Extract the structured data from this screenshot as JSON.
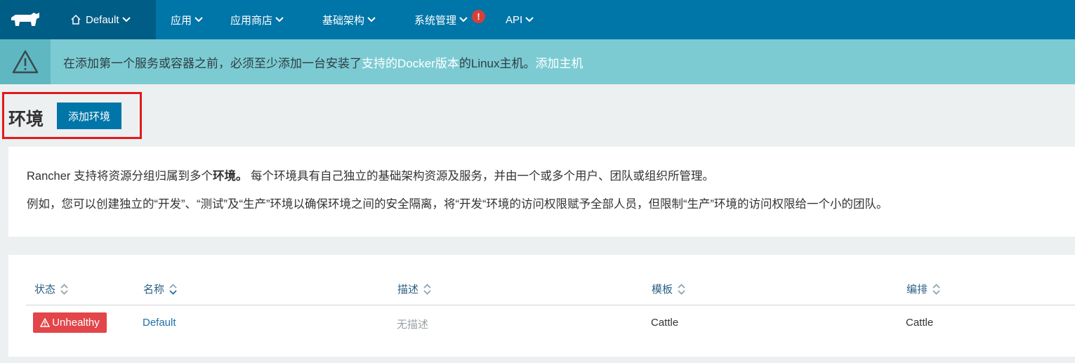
{
  "nav": {
    "environment": "Default",
    "items": [
      {
        "label": "应用"
      },
      {
        "label": "应用商店"
      },
      {
        "label": "基础架构"
      },
      {
        "label": "系统管理"
      },
      {
        "label": "API"
      }
    ],
    "alert_badge": "!"
  },
  "banner": {
    "text_before": "在添加第一个服务或容器之前，必须至少添加一台安装了",
    "link_docker": "支持的Docker版本",
    "text_middle": " 的Linux主机。",
    "link_add_host": "添加主机"
  },
  "page": {
    "title": "环境",
    "add_button": "添加环境"
  },
  "info": {
    "line1_before": "Rancher 支持将资源分组归属到多个",
    "line1_bold": "环境。",
    "line1_after": " 每个环境具有自己独立的基础架构资源及服务，并由一个或多个用户、团队或组织所管理。",
    "line2": "例如，您可以创建独立的“开发”、“测试”及“生产”环境以确保环境之间的安全隔离，将“开发“环境的访问权限赋予全部人员，但限制“生产”环境的访问权限给一个小的团队。"
  },
  "table": {
    "headers": [
      "状态",
      "名称",
      "描述",
      "模板",
      "编排"
    ],
    "rows": [
      {
        "status": "Unhealthy",
        "name": "Default",
        "description": "无描述",
        "template": "Cattle",
        "orchestration": "Cattle"
      }
    ]
  },
  "colors": {
    "nav_bg": "#0075a8",
    "nav_active": "#005d86",
    "banner_bg": "#7ccbd3",
    "status_unhealthy": "#e2464a",
    "highlight_box": "#e21a1a"
  },
  "icons": {
    "logo": "rancher-cow-icon",
    "home": "home-icon",
    "warning": "warning-triangle-icon",
    "sort": "sort-arrows-icon"
  }
}
